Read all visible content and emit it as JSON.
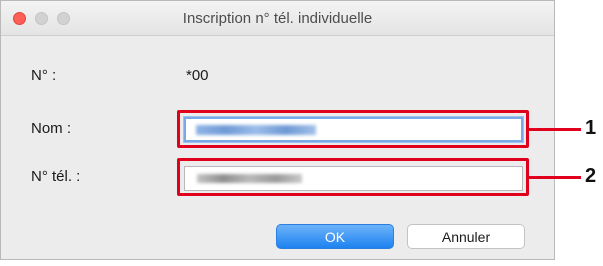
{
  "window": {
    "title": "Inscription n° tél. individuelle"
  },
  "form": {
    "number_label": "N° :",
    "number_value": "*00",
    "name_label": "Nom :",
    "phone_label": "N° tél. :"
  },
  "callouts": {
    "name_marker": "1",
    "phone_marker": "2",
    "color": "#e0001b"
  },
  "buttons": {
    "ok_label": "OK",
    "cancel_label": "Annuler",
    "accent": "#1e82f0"
  }
}
